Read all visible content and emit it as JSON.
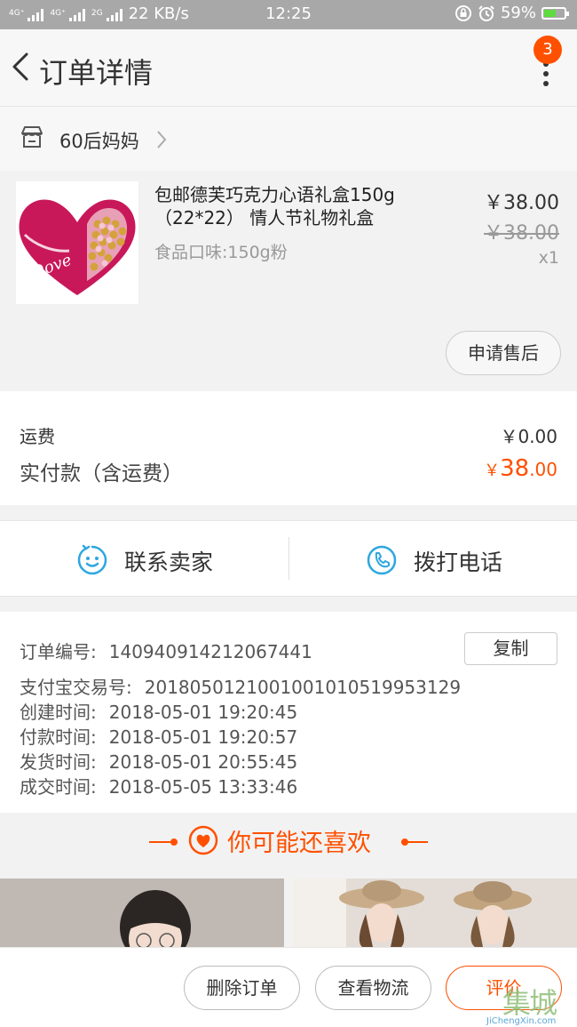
{
  "status_bar": {
    "network_1": "4G⁺",
    "network_2": "4G⁺",
    "network_3": "2G",
    "speed": "22 KB/s",
    "time": "12:25",
    "battery": "59%",
    "battery_level": 0.59
  },
  "header": {
    "title": "订单详情",
    "badge_count": "3"
  },
  "shop": {
    "name": "60后妈妈"
  },
  "product": {
    "title": "包邮德芙巧克力心语礼盒150g（22*22） 情人节礼物礼盒",
    "spec": "食品口味:150g粉",
    "price": "￥38.00",
    "original_price": "￥38.00",
    "quantity": "x1",
    "after_sale_label": "申请售后",
    "thumb_logo_text": "Dove"
  },
  "fees": {
    "shipping_label": "运费",
    "shipping_value": "￥0.00",
    "total_label": "实付款（含运费）",
    "total_currency": "￥",
    "total_int": "38",
    "total_dec": ".00"
  },
  "contact": {
    "seller_label": "联系卖家",
    "phone_label": "拨打电话"
  },
  "order_info": {
    "copy_label": "复制",
    "rows": [
      {
        "label": "订单编号:",
        "value": "140940914212067441"
      },
      {
        "label": "支付宝交易号:",
        "value": "2018050121001001010519953129"
      },
      {
        "label": "创建时间:",
        "value": "2018-05-01 19:20:45"
      },
      {
        "label": "付款时间:",
        "value": "2018-05-01 19:20:57"
      },
      {
        "label": "发货时间:",
        "value": "2018-05-01 20:55:45"
      },
      {
        "label": "成交时间:",
        "value": "2018-05-05 13:33:46"
      }
    ]
  },
  "recommend": {
    "title": "你可能还喜欢"
  },
  "bottom_bar": {
    "delete_label": "删除订单",
    "logistics_label": "查看物流",
    "review_label": "评价"
  },
  "watermark": {
    "cn": "集城信",
    "en": "JiChengXin.com"
  },
  "colors": {
    "accent": "#ff5000",
    "contact_icon": "#2ea7e0",
    "status_bar": "#a8a8a8"
  }
}
